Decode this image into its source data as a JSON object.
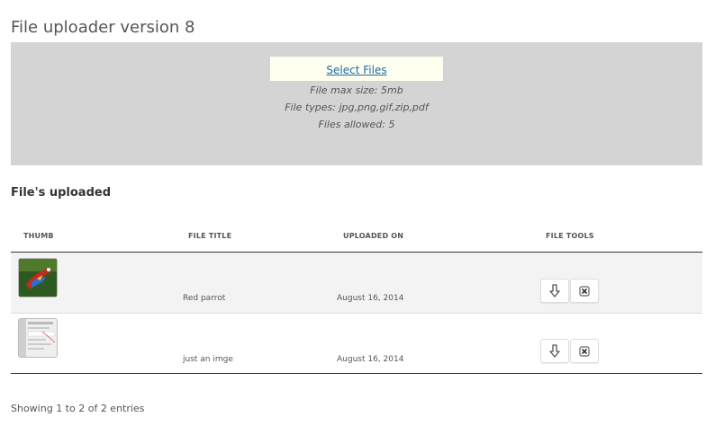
{
  "page": {
    "title": "File uploader version 8"
  },
  "uploader": {
    "select_label": "Select Files",
    "max_size": "File max size: 5mb",
    "file_types": "File types: jpg,png,gif,zip,pdf",
    "files_allowed": "Files allowed: 5"
  },
  "uploaded": {
    "heading": "File's uploaded",
    "columns": [
      "THUMB",
      "FILE TITLE",
      "UPLOADED ON",
      "FILE TOOLS"
    ],
    "rows": [
      {
        "thumb": "parrot-image",
        "title": "Red parrot",
        "date": "August 16, 2014"
      },
      {
        "thumb": "screenshot-image",
        "title": "just an imge",
        "date": "August 16, 2014"
      }
    ]
  },
  "footer": {
    "info": "Showing 1 to 2 of 2 entries"
  },
  "icons": {
    "download": "download-arrow-icon",
    "delete": "delete-x-icon"
  },
  "colors": {
    "dropzone_bg": "#d4d4d4",
    "select_bg": "#fffff0",
    "link": "#1a6aa8",
    "row_bg": "#f3f3f3"
  }
}
